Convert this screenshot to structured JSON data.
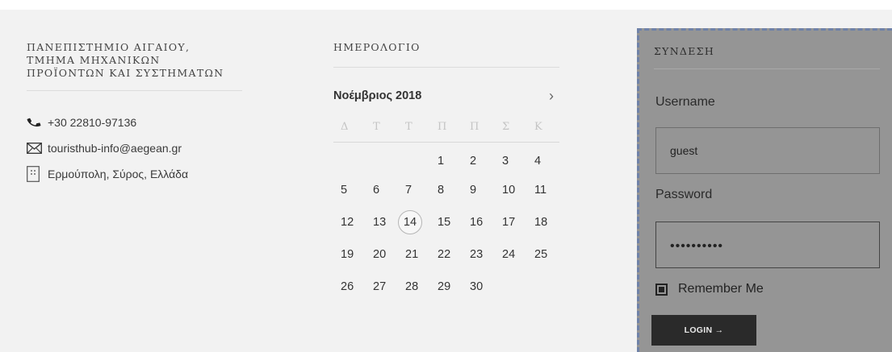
{
  "address": {
    "title_lines": [
      "ΠΑΝΕΠΙΣΤΗΜΙΟ ΑΙΓΑΙΟΥ,",
      "ΤΜΗΜΑ ΜΗΧΑΝΙΚΩΝ",
      "ΠΡΟΪΟΝΤΩΝ ΚΑΙ ΣΥΣΤΗΜΑΤΩΝ"
    ],
    "phone": "+30 22810-97136",
    "email": "touristhub-info@aegean.gr",
    "location": "Ερμούπολη, Σύρος, Ελλάδα",
    "icons": {
      "phone": "phone-icon",
      "email": "envelope-icon",
      "location": "building-icon"
    }
  },
  "calendar": {
    "title": "ΗΜΕΡΟΛΟΓΙΟ",
    "month": "Νοέμβριος 2018",
    "next": "›",
    "weekdays": [
      "Δ",
      "Τ",
      "Τ",
      "Π",
      "Π",
      "Σ",
      "Κ"
    ],
    "weeks": [
      [
        "",
        "",
        "",
        "1",
        "2",
        "3",
        "4"
      ],
      [
        "5",
        "6",
        "7",
        "8",
        "9",
        "10",
        "11"
      ],
      [
        "12",
        "13",
        "14",
        "15",
        "16",
        "17",
        "18"
      ],
      [
        "19",
        "20",
        "21",
        "22",
        "23",
        "24",
        "25"
      ],
      [
        "26",
        "27",
        "28",
        "29",
        "30",
        "",
        ""
      ]
    ],
    "today": "14"
  },
  "login": {
    "title": "ΣΥΝΔΕΣΗ",
    "username_label": "Username",
    "username_value": "guest",
    "password_label": "Password",
    "password_mask": "••••••••••",
    "remember_label": "Remember Me",
    "remember_checked": true,
    "button_label": "LOGIN →"
  },
  "colors": {
    "band": "#f2f2f2",
    "login_panel": "#959595",
    "dashed_outline": "#6f82a8",
    "button": "#2a2a2a"
  }
}
